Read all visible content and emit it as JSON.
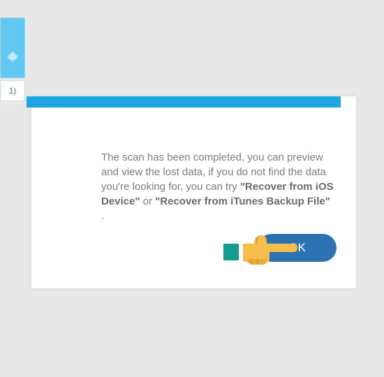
{
  "sidebar": {
    "tile_label": "1)"
  },
  "dialog": {
    "text_prefix": "The scan has been completed, you can preview and view the lost data, if you do not find the data you're looking for, you can try ",
    "option1": "\"Recover from iOS Device\"",
    "joiner": " or ",
    "option2": "\"Recover from iTunes Backup File\"",
    "suffix": ".",
    "ok_label": "OK"
  }
}
